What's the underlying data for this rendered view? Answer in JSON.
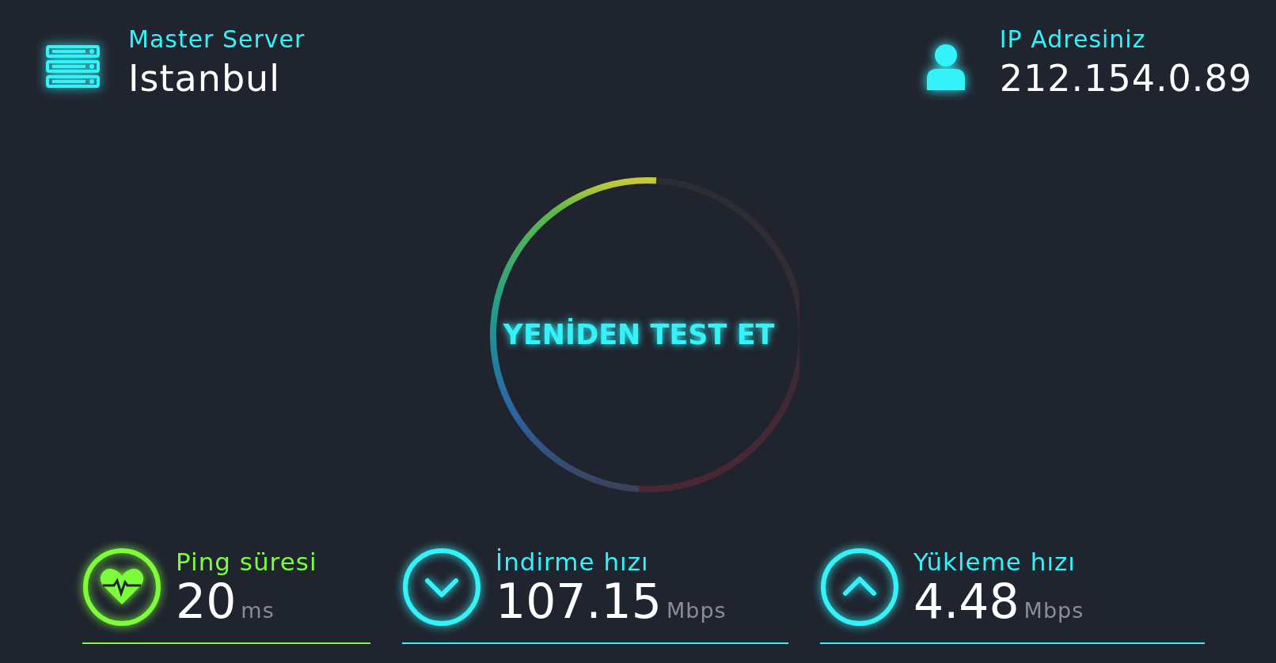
{
  "server": {
    "label": "Master Server",
    "city": "Istanbul"
  },
  "ip": {
    "label": "IP Adresiniz",
    "address": "212.154.0.89"
  },
  "retest_button": "YENİDEN TEST ET",
  "stats": [
    {
      "kind": "ping",
      "label": "Ping süresi",
      "value": "20",
      "unit": "ms",
      "color": "#7cfc3a"
    },
    {
      "kind": "download",
      "label": "İndirme hızı",
      "value": "107.15",
      "unit": "Mbps",
      "color": "#33f3f8"
    },
    {
      "kind": "upload",
      "label": "Yükleme hızı",
      "value": "4.48",
      "unit": "Mbps",
      "color": "#33f3f8"
    }
  ]
}
